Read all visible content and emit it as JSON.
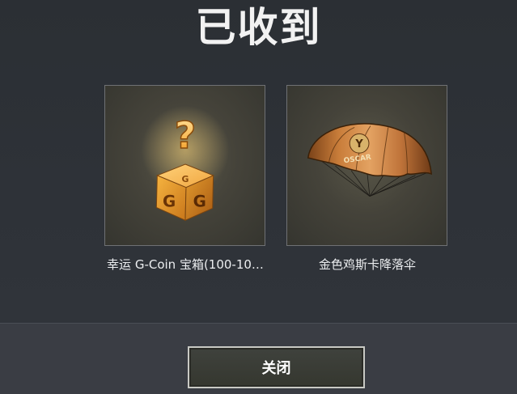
{
  "dialog": {
    "title": "已收到"
  },
  "rewards": [
    {
      "name": "幸运 G-Coin 宝箱(100-10…",
      "icon": "lucky-gcoin-box-icon",
      "box_letters": [
        "G",
        "G",
        "G"
      ],
      "question_mark": "?"
    },
    {
      "name": "金色鸡斯卡降落伞",
      "icon": "golden-parachute-icon",
      "canopy_text": "OSCAR"
    }
  ],
  "footer": {
    "close_label": "关闭"
  },
  "colors": {
    "background": "#2d3036",
    "bottom_bar": "#3a3d44",
    "card_border": "#6f7174",
    "gold": "#e39a2a"
  }
}
